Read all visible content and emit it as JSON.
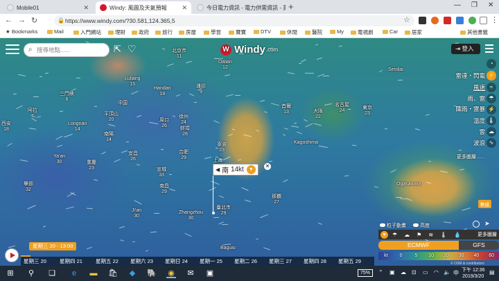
{
  "browser": {
    "tabs": [
      {
        "title": "Mobile01",
        "color": "#e6e6e6"
      },
      {
        "title": "Windy: 風圖及天氣預報",
        "color": "#d4182b"
      },
      {
        "title": "今日電力資訊 - 電力供需資訊 - 業",
        "color": "#e6e6e6"
      }
    ],
    "url": "https://www.windy.com/?30.581,124.365,5",
    "bookmarks": [
      "Bookmarks",
      "Mail",
      "入門網站",
      "理財",
      "政府",
      "旅行",
      "房屋",
      "學習",
      "寶寶",
      "DTV",
      "休閒",
      "醫院",
      "My",
      "電視劇",
      "Car",
      "居家",
      "其他書籤"
    ]
  },
  "map": {
    "search_placeholder": "搜尋地點......",
    "logo_text": "Windy",
    "logo_suffix": ".com",
    "login_label": "登入",
    "layers": [
      "雷達・閃電",
      "風速",
      "雨、雷",
      "降雨・雷暴",
      "溫度",
      "雲",
      "波浪"
    ],
    "more_layers": "更多圖層......",
    "locate_label": "數據",
    "popup": {
      "direction": "南",
      "value": "14kt"
    },
    "places": [
      {
        "name": "北京市",
        "v": "11"
      },
      {
        "name": "Dalian",
        "v": "12"
      },
      {
        "name": "Luliang",
        "v": "15"
      },
      {
        "name": "Handan",
        "v": "18"
      },
      {
        "name": "濰坊",
        "v": "9"
      },
      {
        "name": "首爾",
        "v": "13"
      },
      {
        "name": "Sendai",
        "v": ""
      },
      {
        "name": "三門峽",
        "v": "6"
      },
      {
        "name": "平頂山",
        "v": "20"
      },
      {
        "name": "中国",
        "v": ""
      },
      {
        "name": "徐州",
        "v": "24"
      },
      {
        "name": "阿拉",
        "v": "7"
      },
      {
        "name": "西安",
        "v": "18"
      },
      {
        "name": "南陽",
        "v": "14"
      },
      {
        "name": "Longnan",
        "v": "14"
      },
      {
        "name": "周口",
        "v": "26"
      },
      {
        "name": "蚌埠",
        "v": "28"
      },
      {
        "name": "大阪",
        "v": "22"
      },
      {
        "name": "名古屋",
        "v": "24"
      },
      {
        "name": "東京",
        "v": "23"
      },
      {
        "name": "Kagoshima",
        "v": ""
      },
      {
        "name": "Ya'an",
        "v": "30"
      },
      {
        "name": "重慶",
        "v": "23"
      },
      {
        "name": "宜昌",
        "v": "26"
      },
      {
        "name": "合肥",
        "v": "29"
      },
      {
        "name": "寧波",
        "v": "23"
      },
      {
        "name": "上海",
        "v": "21"
      },
      {
        "name": "宣城",
        "v": "33"
      },
      {
        "name": "南昌",
        "v": "29"
      },
      {
        "name": "Ji'an",
        "v": "30"
      },
      {
        "name": "Zhangzhou",
        "v": "30"
      },
      {
        "name": "臺北市",
        "v": "29"
      },
      {
        "name": "那覇",
        "v": "27"
      },
      {
        "name": "畢節",
        "v": "32"
      },
      {
        "name": "Ogasawara",
        "v": ""
      },
      {
        "name": "Baguio",
        "v": ""
      }
    ]
  },
  "toggles": [
    "粒子動畫",
    "高度"
  ],
  "more_label": "更多圖層",
  "models": {
    "primary": "ECMWF",
    "secondary": "GFS"
  },
  "scale": [
    "kt",
    "0",
    "5",
    "10",
    "20",
    "30",
    "40",
    "60"
  ],
  "attribution": "© OSM & contributors",
  "timeline": {
    "current": "星期三 20 - 13:00",
    "days": [
      "星期三 20",
      "星期四 21",
      "星期五 22",
      "星期六 23",
      "星期日 24",
      "星期一 25",
      "星期二 26",
      "星期三 27",
      "星期四 28",
      "星期五 29"
    ]
  },
  "taskbar": {
    "battery": "75%",
    "time": "下午 12:36",
    "date": "2019/3/20",
    "tray_lang": "中"
  }
}
